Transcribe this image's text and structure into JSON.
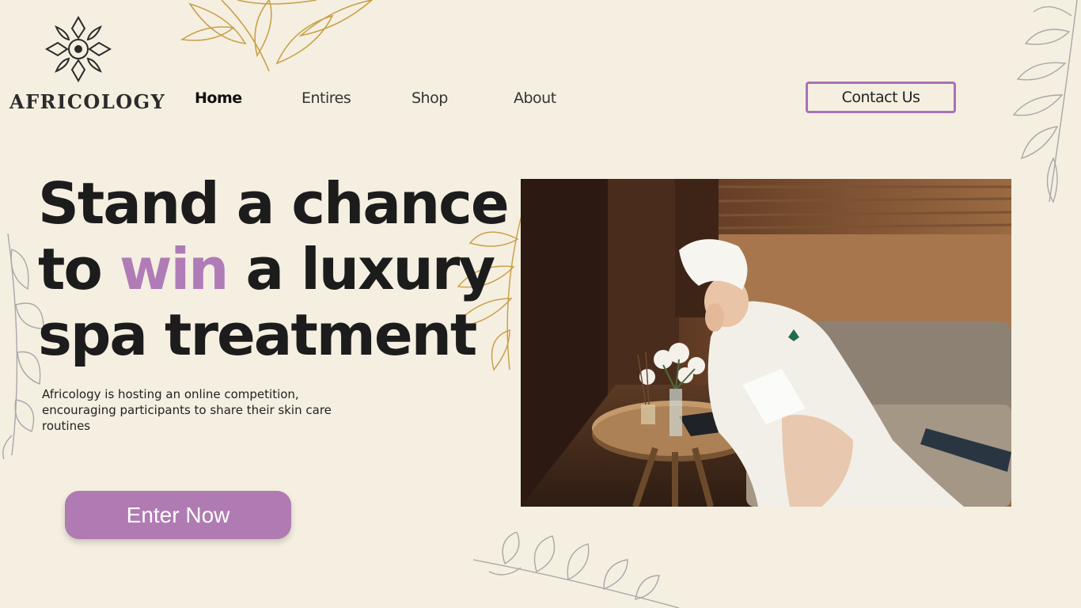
{
  "brand": {
    "name": "AFRICOLOGY",
    "logo_icon": "ornamental-mandala-logo"
  },
  "nav": {
    "items": [
      {
        "label": "Home",
        "active": true
      },
      {
        "label": "Entires",
        "active": false
      },
      {
        "label": "Shop",
        "active": false
      },
      {
        "label": "About",
        "active": false
      }
    ],
    "contact_label": "Contact Us"
  },
  "hero": {
    "line1": "Stand a chance",
    "line2_pre": "to ",
    "line2_accent": "win",
    "line2_post": " a luxury",
    "line3": "spa treatment",
    "description": "Africology is hosting an online competition, encouraging participants to share their skin care routines",
    "cta_label": "Enter Now",
    "image": "woman-in-bathrobe-reading-at-spa-photo"
  },
  "decor": {
    "leaf_gold": "gold-leaf-branch",
    "leaf_grey": "grey-leaf-branch"
  },
  "colors": {
    "background": "#f5efe1",
    "accent": "#b07cb7",
    "button": "#b07ab3",
    "text": "#1c1c1c"
  }
}
